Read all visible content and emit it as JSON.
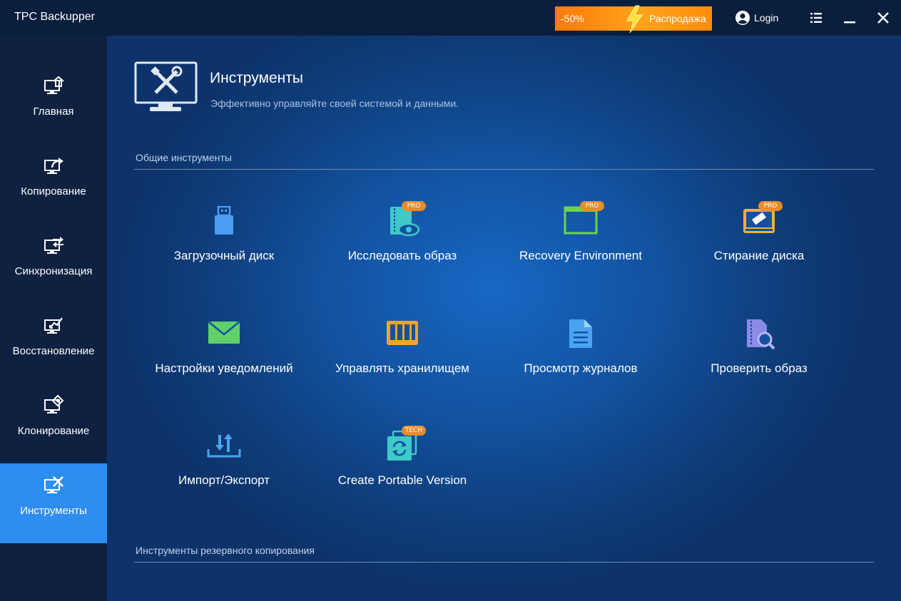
{
  "app": {
    "title": "TPC Backupper"
  },
  "titlebar": {
    "promo_percent": "-50%",
    "promo_text": "Распродажа",
    "login_label": "Login"
  },
  "sidebar": {
    "items": [
      {
        "label": "Главная",
        "icon": "home-monitor-icon"
      },
      {
        "label": "Копирование",
        "icon": "backup-monitor-icon"
      },
      {
        "label": "Синхронизация",
        "icon": "sync-monitor-icon"
      },
      {
        "label": "Восстановление",
        "icon": "restore-monitor-icon"
      },
      {
        "label": "Клонирование",
        "icon": "clone-monitor-icon"
      },
      {
        "label": "Инструменты",
        "icon": "tools-monitor-icon",
        "active": true
      }
    ]
  },
  "header": {
    "title": "Инструменты",
    "subtitle": "Эффективно управляйте своей системой и данными."
  },
  "sections": {
    "common": "Общие инструменты",
    "backup": "Инструменты резервного копирования"
  },
  "tools": [
    {
      "label": "Загрузочный диск",
      "icon": "usb-drive-icon"
    },
    {
      "label": "Исследовать образ",
      "icon": "explore-image-icon",
      "badge": "PRO"
    },
    {
      "label": "Recovery Environment",
      "icon": "recovery-window-icon",
      "badge": "PRO"
    },
    {
      "label": "Стирание диска",
      "icon": "disk-eraser-icon",
      "badge": "PRO"
    },
    {
      "label": "Настройки уведомлений",
      "icon": "envelope-icon"
    },
    {
      "label": "Управлять хранилищем",
      "icon": "storage-icon"
    },
    {
      "label": "Просмотр журналов",
      "icon": "log-document-icon"
    },
    {
      "label": "Проверить образ",
      "icon": "check-image-icon"
    },
    {
      "label": "Импорт/Экспорт",
      "icon": "import-export-icon"
    },
    {
      "label": "Create Portable Version",
      "icon": "portable-version-icon",
      "badge": "TECH"
    }
  ],
  "colors": {
    "sidebar_active": "#2e8df0",
    "promo_orange": "#ff9a10",
    "badge_orange": "#e88b2a"
  }
}
